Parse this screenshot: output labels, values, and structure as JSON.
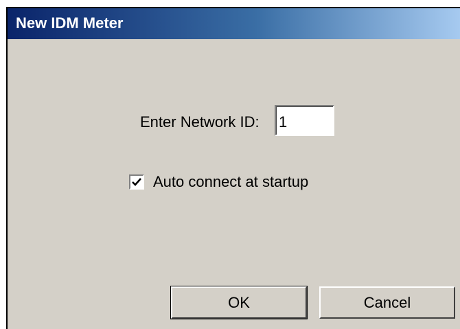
{
  "window": {
    "title": "New IDM Meter"
  },
  "form": {
    "network_id_label": "Enter Network ID:",
    "network_id_value": "1",
    "auto_connect_label": "Auto connect at startup",
    "auto_connect_checked": true
  },
  "buttons": {
    "ok_label": "OK",
    "cancel_label": "Cancel"
  },
  "icons": {
    "checkbox_mark": "check-icon"
  }
}
